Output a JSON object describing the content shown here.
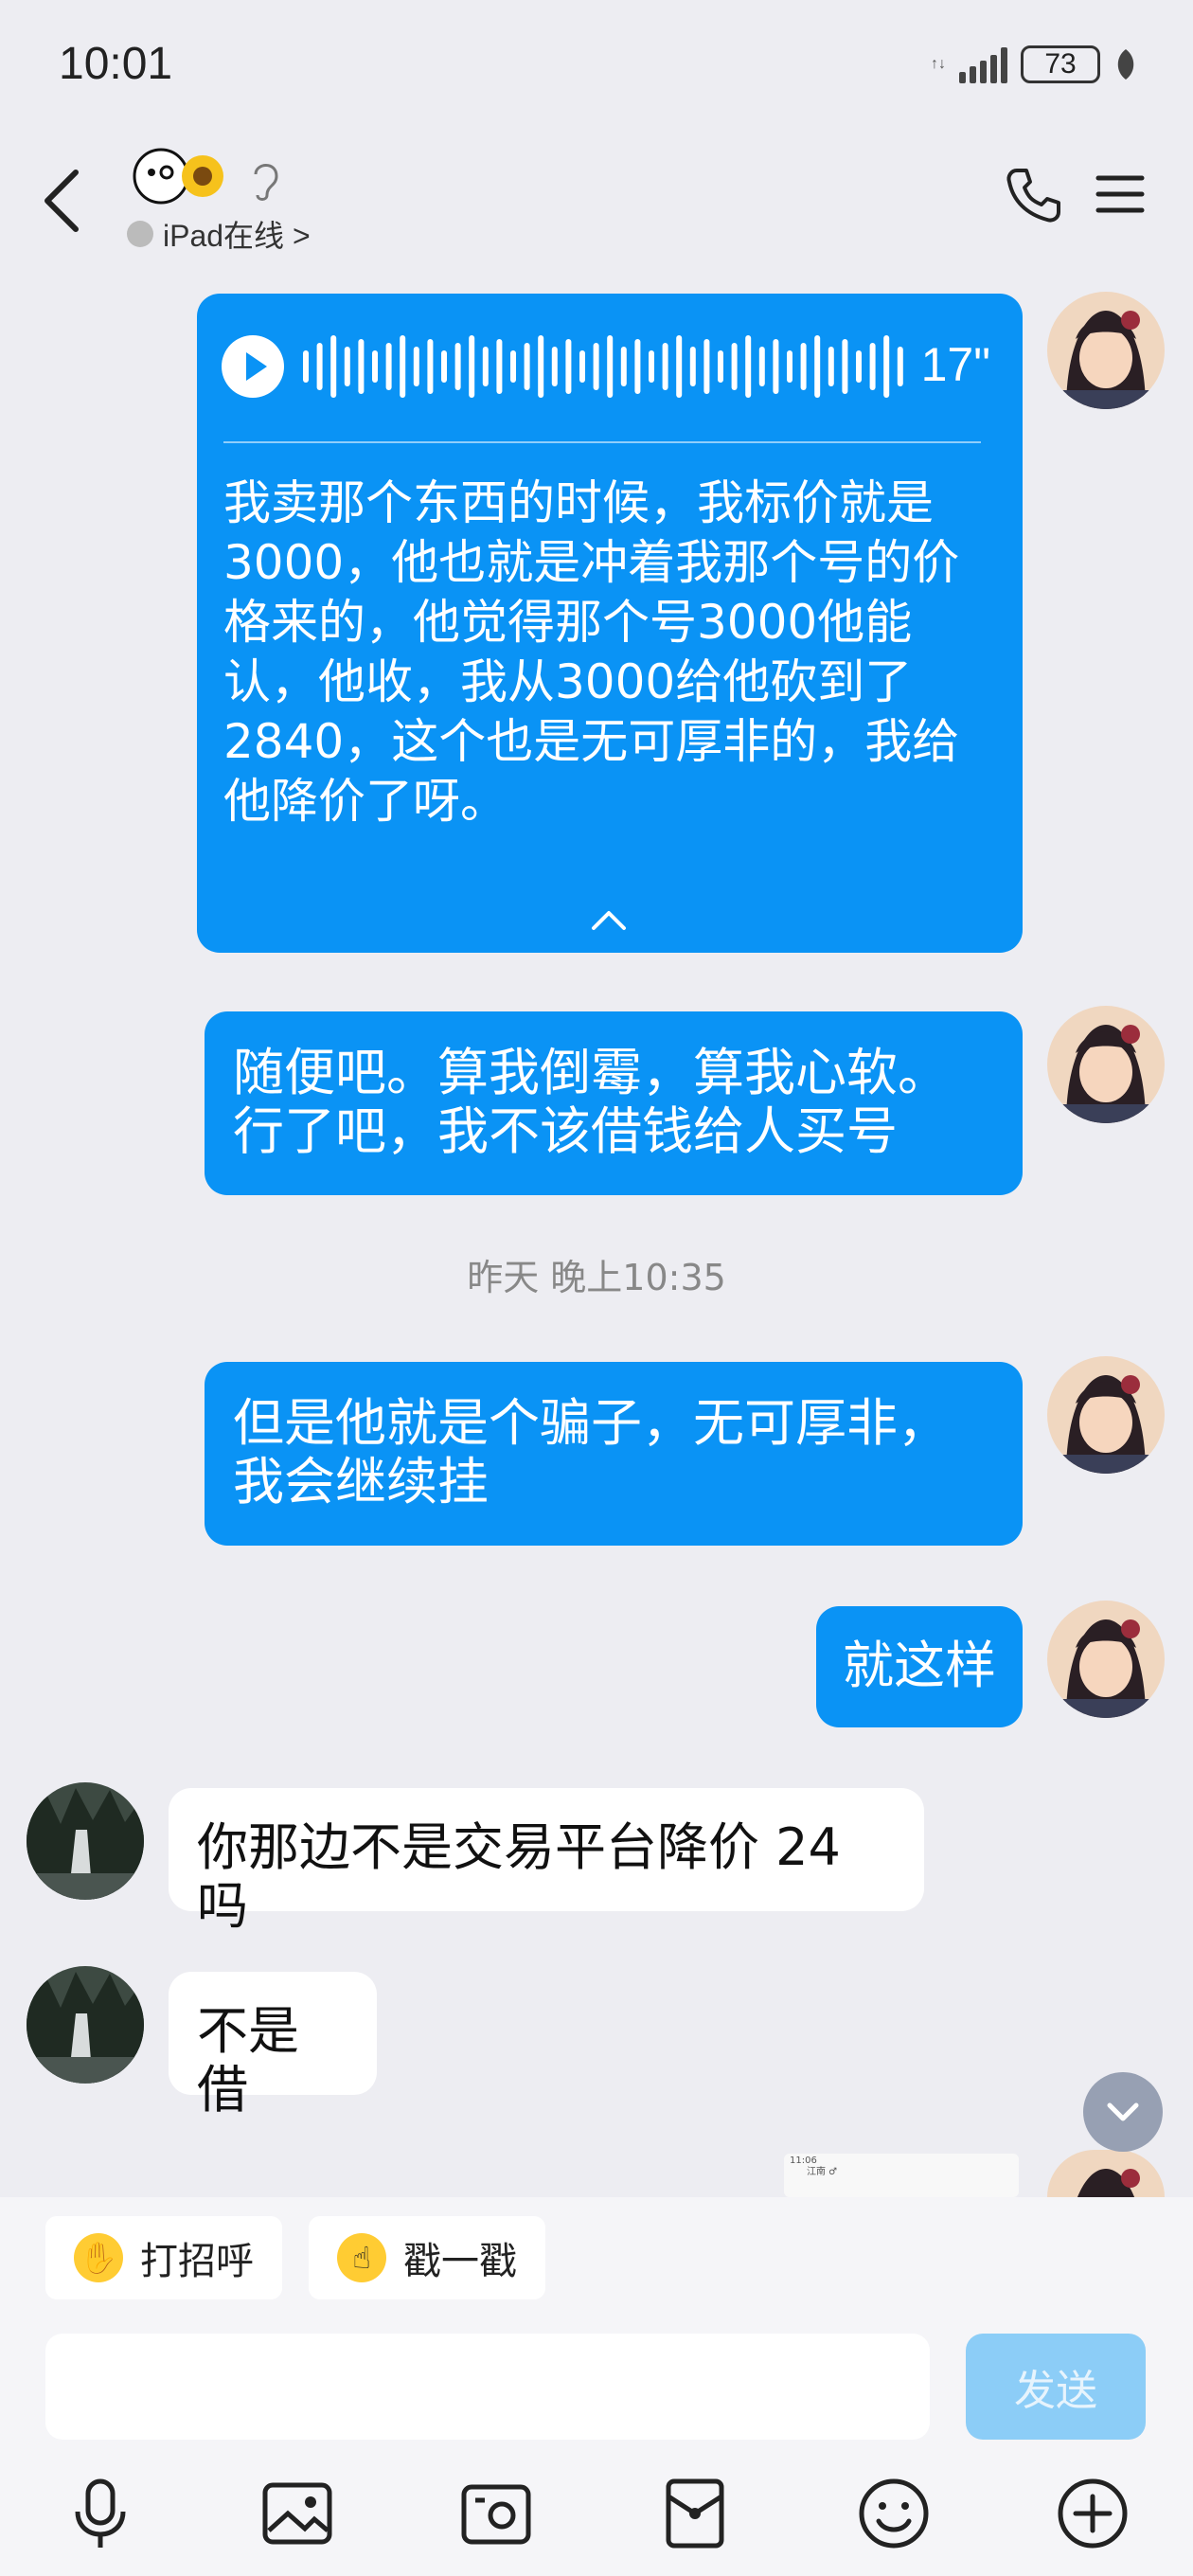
{
  "status_bar": {
    "time": "10:01",
    "battery": "73"
  },
  "header": {
    "online_status": "iPad在线 >"
  },
  "messages": {
    "voice": {
      "duration": "17\"",
      "transcript": "我卖那个东西的时候，我标价就是3000，他也就是冲着我那个号的价格来的，他觉得那个号3000他能认，他收，我从3000给他砍到了2840，这个也是无可厚非的，我给他降价了呀。"
    },
    "out_1": "随便吧。算我倒霉，算我心软。行了吧，我不该借钱给人买号",
    "timestamp": "昨天 晚上10:35",
    "out_2": "但是他就是个骗子，无可厚非，我会继续挂",
    "out_3": "就这样",
    "in_1": "你那边不是交易平台降价 24 吗",
    "in_2": "不是借"
  },
  "preview": {
    "time": "11:06",
    "name": "江南 ♂"
  },
  "quick_actions": {
    "greet": "打招呼",
    "poke": "戳一戳"
  },
  "composer": {
    "placeholder": "",
    "send": "发送"
  },
  "colors": {
    "accent": "#0a93f5",
    "background": "#ededf2",
    "send_disabled": "#8ccdf7"
  }
}
